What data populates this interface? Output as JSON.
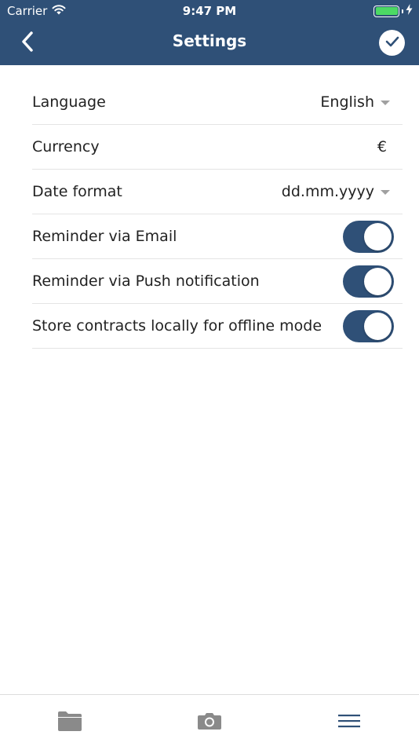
{
  "status_bar": {
    "carrier": "Carrier",
    "time": "9:47 PM",
    "battery_level": 1.0
  },
  "nav": {
    "title": "Settings",
    "back_icon": "chevron-left-icon",
    "confirm_icon": "check-circle-icon"
  },
  "settings": {
    "language": {
      "label": "Language",
      "value": "English"
    },
    "currency": {
      "label": "Currency",
      "value": "€"
    },
    "date_format": {
      "label": "Date format",
      "value": "dd.mm.yyyy"
    },
    "email_reminder": {
      "label": "Reminder via Email",
      "enabled": true
    },
    "push_reminder": {
      "label": "Reminder via Push notification",
      "enabled": true
    },
    "offline_storage": {
      "label": "Store contracts locally for offline mode",
      "enabled": true
    }
  },
  "tab_bar": {
    "items": [
      {
        "icon": "folder-icon"
      },
      {
        "icon": "camera-icon"
      },
      {
        "icon": "menu-icon"
      }
    ]
  },
  "colors": {
    "primary": "#2f5077",
    "toggle_on": "#2f5077",
    "tab_icon": "#8a8a8a",
    "battery": "#4cd964"
  }
}
